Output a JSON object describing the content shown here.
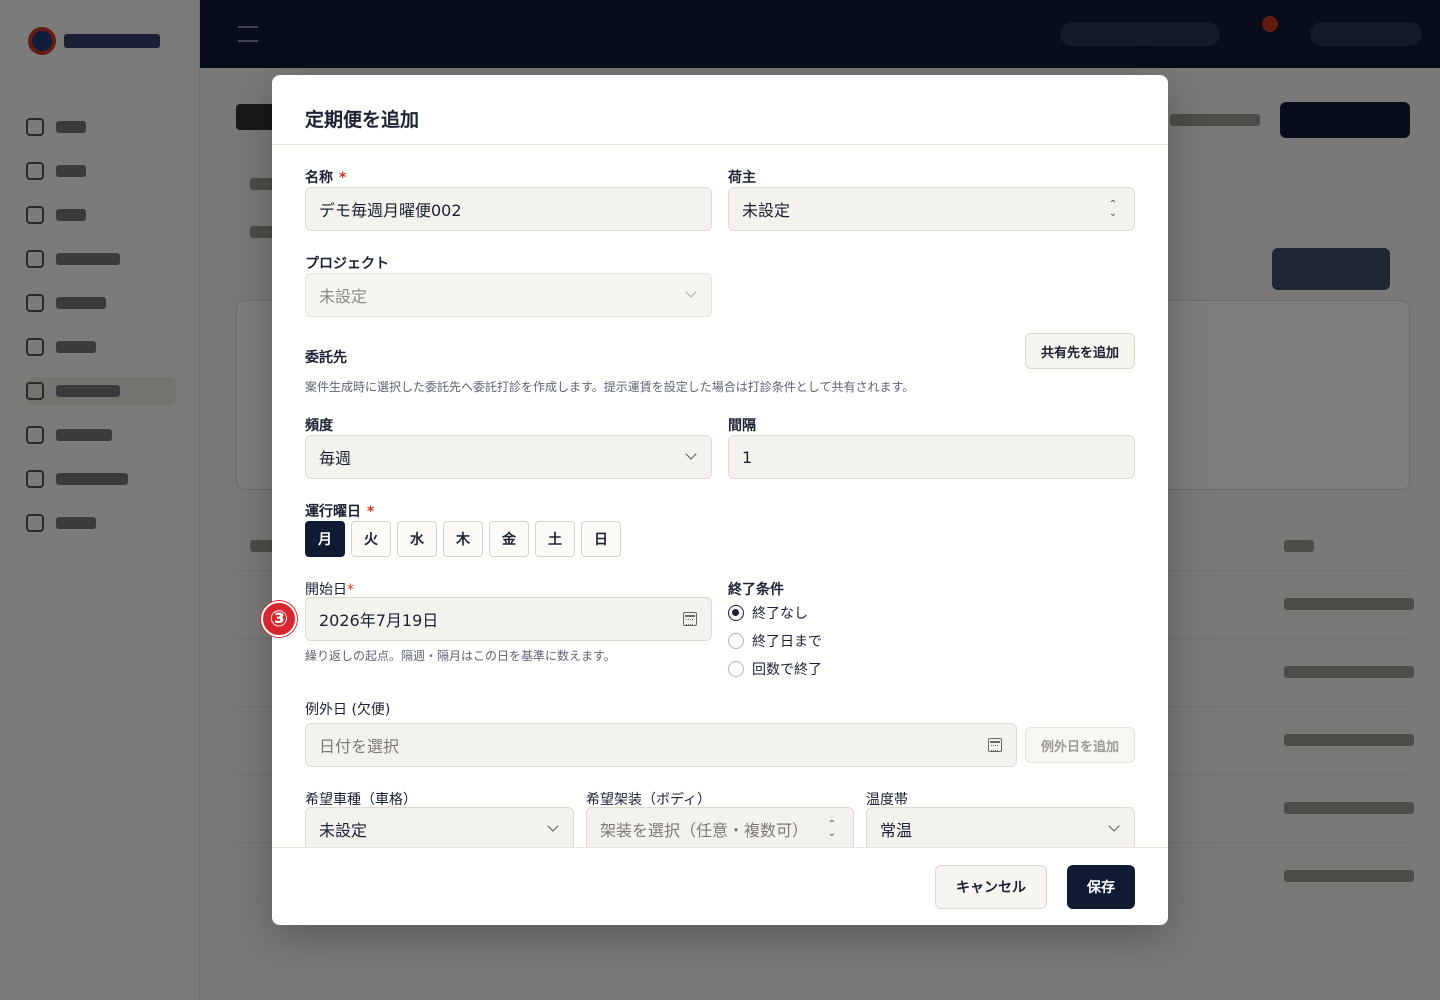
{
  "modal": {
    "title": "定期便を追加",
    "name_label": "名称",
    "name_value": "デモ毎週月曜便002",
    "shipper_label": "荷主",
    "shipper_value": "未設定",
    "project_label": "プロジェクト",
    "project_value": "未設定",
    "subcontractor_label": "委託先",
    "add_share_button": "共有先を追加",
    "subcontractor_help": "案件生成時に選択した委託先へ委託打診を作成します。提示運賃を設定した場合は打診条件として共有されます。",
    "frequency_label": "頻度",
    "frequency_value": "毎週",
    "interval_label": "間隔",
    "interval_value": "1",
    "weekday_label": "運行曜日",
    "required_mark": "*",
    "weekdays": [
      {
        "label": "月",
        "selected": true
      },
      {
        "label": "火",
        "selected": false
      },
      {
        "label": "水",
        "selected": false
      },
      {
        "label": "木",
        "selected": false
      },
      {
        "label": "金",
        "selected": false
      },
      {
        "label": "土",
        "selected": false
      },
      {
        "label": "日",
        "selected": false
      }
    ],
    "start_date_label": "開始日",
    "start_date_value": "2026年7月19日",
    "start_date_help": "繰り返しの起点。隔週・隔月はこの日を基準に数えます。",
    "end_condition_label": "終了条件",
    "end_options": [
      {
        "label": "終了なし",
        "selected": true
      },
      {
        "label": "終了日まで",
        "selected": false
      },
      {
        "label": "回数で終了",
        "selected": false
      }
    ],
    "exception_label": "例外日 (欠便)",
    "exception_placeholder": "日付を選択",
    "add_exception_button": "例外日を追加",
    "vehicle_label": "希望車種（車格）",
    "vehicle_value": "未設定",
    "body_label": "希望架装（ボディ）",
    "body_placeholder": "架装を選択（任意・複数可）",
    "temperature_label": "温度帯",
    "temperature_value": "常温",
    "cancel_button": "キャンセル",
    "save_button": "保存"
  },
  "annotation": {
    "step_badge": "③"
  },
  "colors": {
    "primary": "#0f1b33",
    "required": "#c0392b",
    "badge": "#d7262e"
  }
}
